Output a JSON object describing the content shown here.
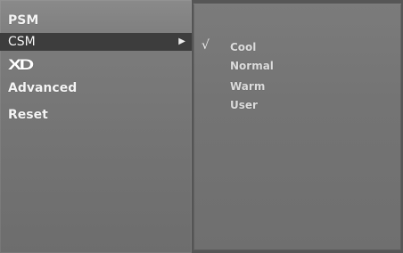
{
  "left_menu": {
    "items": [
      {
        "label": "PSM"
      },
      {
        "label": "CSM"
      },
      {
        "label": "XD"
      },
      {
        "label": "Advanced"
      },
      {
        "label": "Reset"
      }
    ],
    "selected_index": 1,
    "submenu_arrow": "▶"
  },
  "right_menu": {
    "check_mark": "√",
    "items": [
      {
        "label": "Cool"
      },
      {
        "label": "Normal"
      },
      {
        "label": "Warm"
      },
      {
        "label": "User"
      }
    ],
    "checked_index": 0
  }
}
